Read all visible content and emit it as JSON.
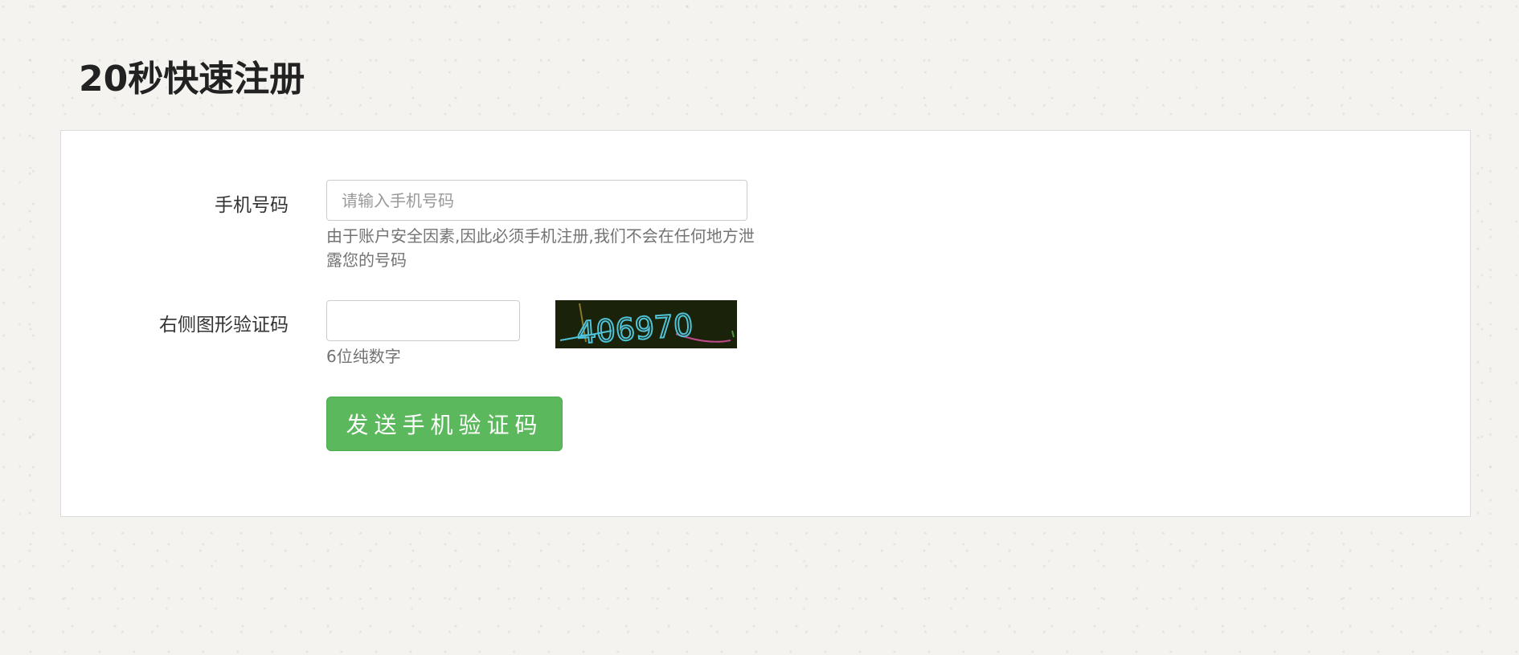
{
  "page": {
    "title": "20秒快速注册"
  },
  "form": {
    "phone": {
      "label": "手机号码",
      "placeholder": "请输入手机号码",
      "value": "",
      "help": "由于账户安全因素,因此必须手机注册,我们不会在任何地方泄露您的号码"
    },
    "captcha": {
      "label": "右侧图形验证码",
      "value": "",
      "help": "6位纯数字",
      "image_text": "406970"
    },
    "submit_label": "发送手机验证码"
  },
  "colors": {
    "button_bg": "#5cb85c",
    "captcha_bg": "#1a2209",
    "captcha_text": "#4fc3d9"
  }
}
